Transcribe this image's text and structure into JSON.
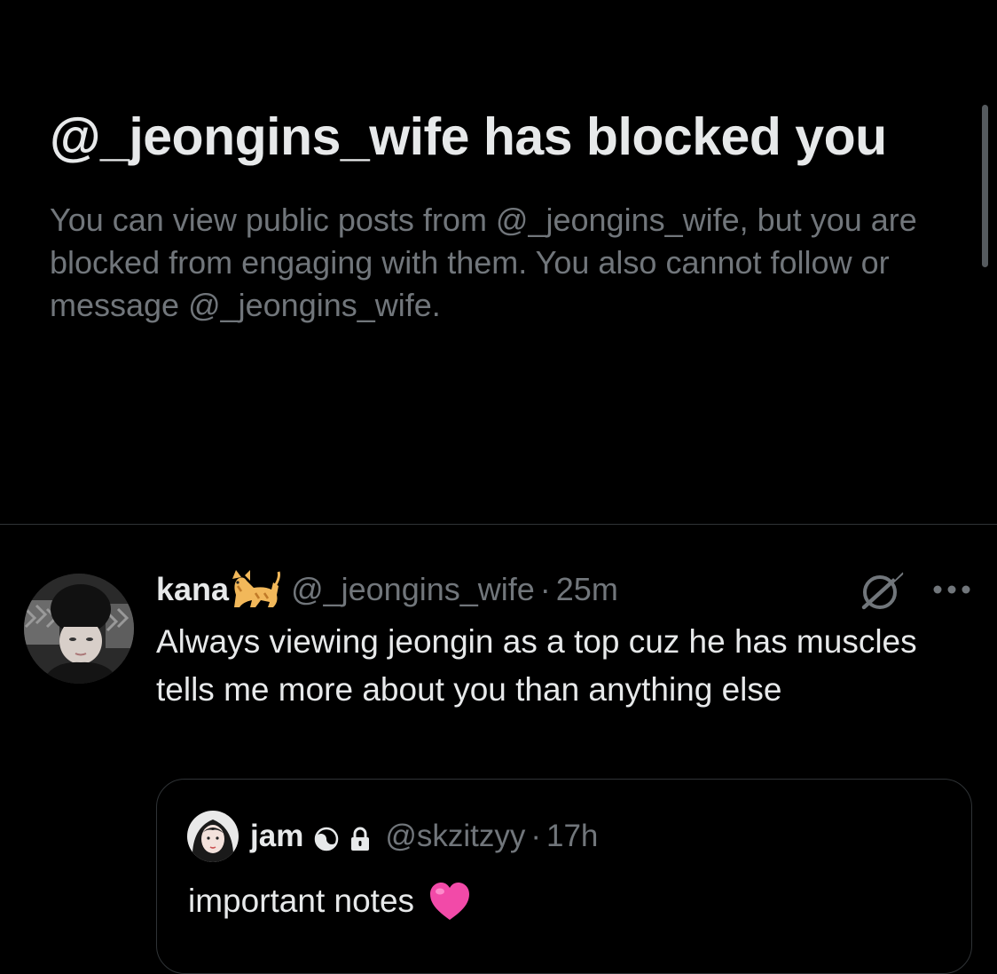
{
  "blocked": {
    "title": "@_jeongins_wife has blocked you",
    "description": "You can view public posts from @_jeongins_wife, but you are blocked from engaging with them. You also cannot follow or message @_jeongins_wife."
  },
  "post": {
    "display_name": "kana",
    "name_emoji": "cat-emoji",
    "handle": "@_jeongins_wife",
    "separator": "·",
    "time": "25m",
    "text": "Always viewing jeongin as a top cuz he has muscles tells me more about you than anything else",
    "actions": {
      "grok_icon": "grok-icon",
      "more_icon": "more-icon"
    }
  },
  "quoted_post": {
    "display_name": "jam",
    "badge_icon": "yin-yang-icon",
    "protected_icon": "lock-icon",
    "handle": "@skzitzyy",
    "separator": "·",
    "time": "17h",
    "text": "important notes",
    "text_emoji": "pink-heart-icon"
  },
  "colors": {
    "background": "#000000",
    "primary_text": "#e7e9ea",
    "secondary_text": "#71767b",
    "border": "#2f3336",
    "heart": "#f24aa8"
  }
}
